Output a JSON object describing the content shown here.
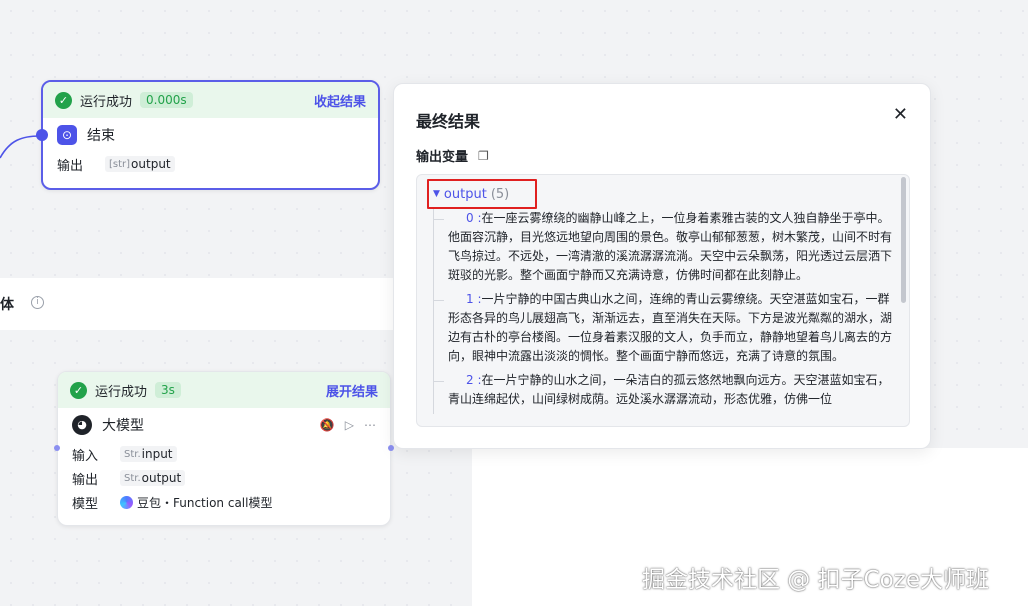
{
  "end_node": {
    "status": "运行成功",
    "time": "0.000s",
    "toggle": "收起结果",
    "title": "结束",
    "output_label": "输出",
    "output_type": "[str]",
    "output_value": "output"
  },
  "section": {
    "title": "体",
    "info_icon": "info-icon"
  },
  "llm_node": {
    "status": "运行成功",
    "time": "3s",
    "toggle": "展开结果",
    "title": "大模型",
    "rows": [
      {
        "label": "输入",
        "type": "Str.",
        "value": "input"
      },
      {
        "label": "输出",
        "type": "Str.",
        "value": "output"
      },
      {
        "label": "模型",
        "type": "",
        "value": "豆包・Function call模型"
      }
    ],
    "action_icons": [
      "bell-off-icon",
      "play-icon",
      "more-icon"
    ]
  },
  "panel": {
    "title": "最终结果",
    "close": "✕",
    "var_label": "输出变量",
    "output_key": "output",
    "output_count": "(5)",
    "items": [
      {
        "idx": "0 :",
        "text": "在一座云雾缭绕的幽静山峰之上，一位身着素雅古装的文人独自静坐于亭中。他面容沉静，目光悠远地望向周围的景色。敬亭山郁郁葱葱，树木繁茂，山间不时有飞鸟掠过。不远处，一湾清澈的溪流潺潺流淌。天空中云朵飘荡，阳光透过云层洒下斑驳的光影。整个画面宁静而又充满诗意，仿佛时间都在此刻静止。"
      },
      {
        "idx": "1 :",
        "text": "一片宁静的中国古典山水之间，连绵的青山云雾缭绕。天空湛蓝如宝石，一群形态各异的鸟儿展翅高飞，渐渐远去，直至消失在天际。下方是波光粼粼的湖水，湖边有古朴的亭台楼阁。一位身着素汉服的文人，负手而立，静静地望着鸟儿离去的方向，眼神中流露出淡淡的惆怅。整个画面宁静而悠远，充满了诗意的氛围。"
      },
      {
        "idx": "2 :",
        "text": "在一片宁静的山水之间，一朵洁白的孤云悠然地飘向远方。天空湛蓝如宝石，青山连绵起伏，山间绿树成荫。远处溪水潺潺流动，形态优雅，仿佛一位"
      }
    ]
  },
  "watermark": "掘金技术社区 @ 扣子Coze大师班"
}
